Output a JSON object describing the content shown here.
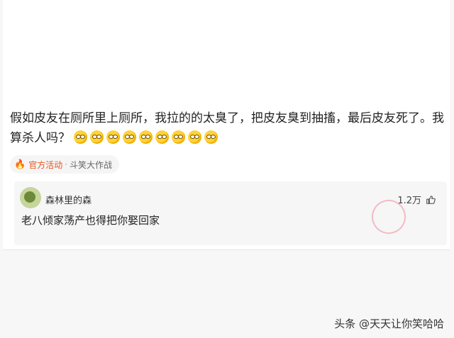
{
  "post": {
    "text": "假如皮友在厕所里上厕所，我拉的的太臭了，把皮友臭到抽搐，最后皮友死了。我算杀人吗？",
    "emoji_count": 9,
    "emoji_icon": "pleading-face-emoji"
  },
  "tag": {
    "icon": "flame-icon",
    "type": "官方活动",
    "separator": "·",
    "name": "斗笑大作战"
  },
  "reply": {
    "username": "森林里的森",
    "likes": "1.2万",
    "text": "老八倾家荡产也得把你娶回家",
    "badge_icon": "god-comment-stamp"
  },
  "watermark": "头条 @天天让你笑哈哈"
}
